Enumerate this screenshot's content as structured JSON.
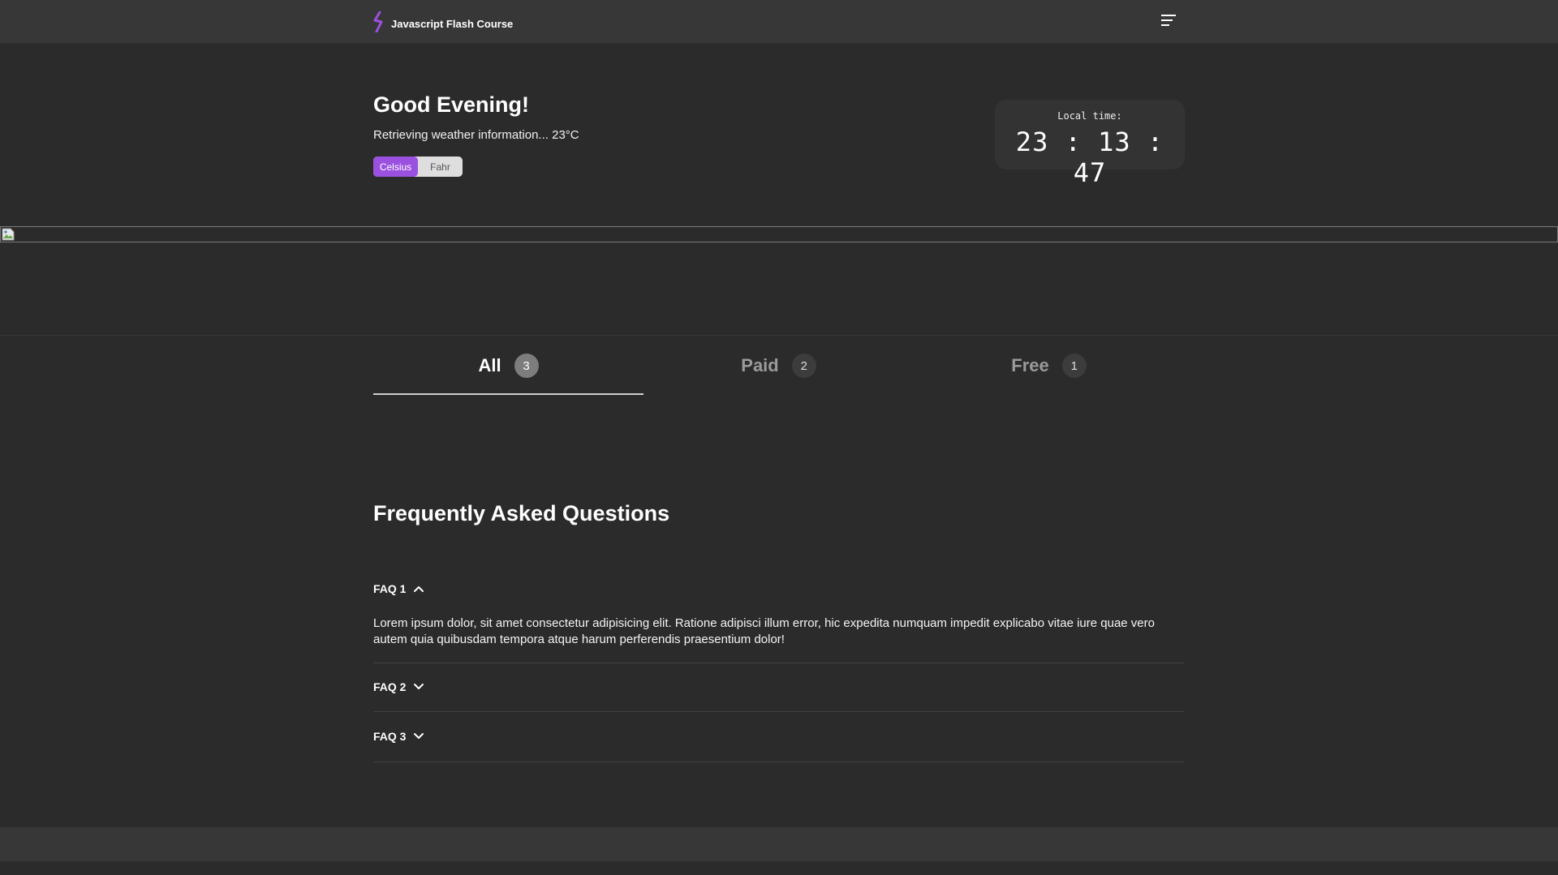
{
  "header": {
    "brand_title": "Javascript Flash Course",
    "logo_icon": "lightning-bolt-icon",
    "menu_icon": "hamburger-menu-icon",
    "accent_color": "#9b51e0"
  },
  "hero": {
    "greeting": "Good Evening!",
    "weather_text": "Retrieving weather information... 23°C",
    "unit_toggle": {
      "celsius_label": "Celsius",
      "fahr_label": "Fahr",
      "selected": "Celsius"
    }
  },
  "clock": {
    "label": "Local time:",
    "time": "23 : 13 : 47"
  },
  "banner": {
    "icon": "broken-image-icon"
  },
  "tabs": [
    {
      "label": "All",
      "count": "3",
      "active": true
    },
    {
      "label": "Paid",
      "count": "2",
      "active": false
    },
    {
      "label": "Free",
      "count": "1",
      "active": false
    }
  ],
  "faq": {
    "title": "Frequently Asked Questions",
    "items": [
      {
        "question": "FAQ 1",
        "expanded": true,
        "answer": "Lorem ipsum dolor, sit amet consectetur adipisicing elit. Ratione adipisci illum error, hic expedita numquam impedit explicabo vitae iure quae vero autem quia quibusdam tempora atque harum perferendis praesentium dolor!",
        "icon": "chevron-up-icon"
      },
      {
        "question": "FAQ 2",
        "expanded": false,
        "icon": "chevron-down-icon"
      },
      {
        "question": "FAQ 3",
        "expanded": false,
        "icon": "chevron-down-icon"
      }
    ]
  }
}
